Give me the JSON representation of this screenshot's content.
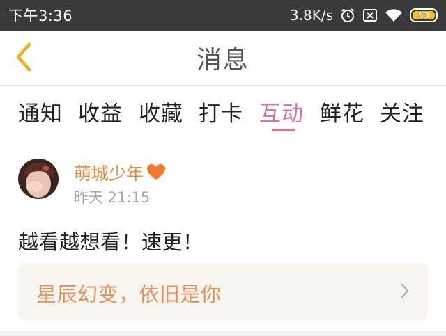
{
  "status_bar": {
    "time": "下午3:36",
    "net_speed": "3.8K/s",
    "battery": "53",
    "icons": [
      "alarm-icon",
      "sim-icon",
      "wifi-icon",
      "battery-icon"
    ]
  },
  "nav": {
    "title": "消息",
    "back_icon": "chevron-left-icon"
  },
  "tabs": [
    {
      "label": "通知",
      "active": false
    },
    {
      "label": "收益",
      "active": false
    },
    {
      "label": "收藏",
      "active": false
    },
    {
      "label": "打卡",
      "active": false
    },
    {
      "label": "互动",
      "active": true
    },
    {
      "label": "鲜花",
      "active": false
    },
    {
      "label": "关注",
      "active": false
    }
  ],
  "comment": {
    "username": "萌城少年",
    "time": "昨天 21:15",
    "text": "越看越想看！速更！",
    "ref_title": "星辰幻变，依旧是你"
  },
  "colors": {
    "accent": "#e0709d",
    "username": "#ee8a3e",
    "ref_title": "#e8915a",
    "back": "#e3b52b"
  }
}
